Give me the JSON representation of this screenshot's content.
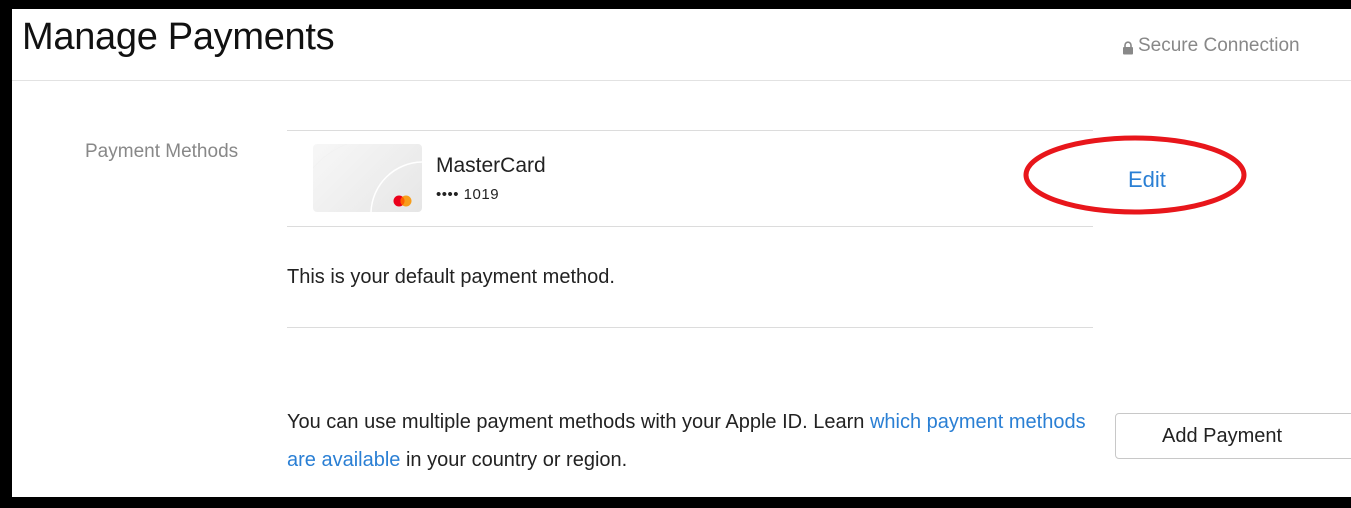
{
  "header": {
    "title": "Manage Payments",
    "secure_label": "Secure Connection"
  },
  "payment_methods": {
    "section_label": "Payment Methods",
    "card": {
      "brand": "MasterCard",
      "number_masked": "•••• 1019",
      "icon": "mastercard-logo-icon"
    },
    "edit_label": "Edit",
    "default_note": "This is your default payment method."
  },
  "info": {
    "text_before_link": "You can use multiple payment methods with your Apple ID. Learn ",
    "link_text": "which payment methods are available",
    "text_after_link": " in your country or region."
  },
  "actions": {
    "add_payment_label": "Add Payment"
  },
  "annotation": {
    "color": "#e8161b",
    "shape": "ellipse-around-edit"
  },
  "colors": {
    "link": "#2a7fd4",
    "muted": "#888888"
  }
}
